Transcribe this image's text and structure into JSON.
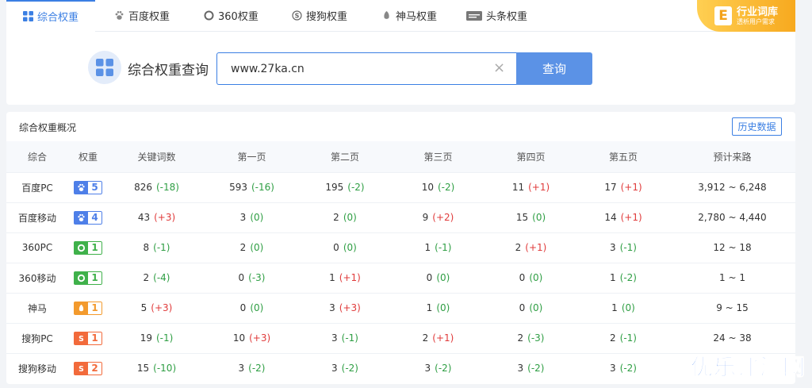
{
  "tabs": [
    {
      "label": "综合权重",
      "icon": "grid-icon",
      "active": true
    },
    {
      "label": "百度权重",
      "icon": "baidu-paw-icon"
    },
    {
      "label": "360权重",
      "icon": "360-ring-icon"
    },
    {
      "label": "搜狗权重",
      "icon": "sogou-s-icon"
    },
    {
      "label": "神马权重",
      "icon": "shenma-icon"
    },
    {
      "label": "头条权重",
      "icon": "toutiao-icon"
    }
  ],
  "banner": {
    "title": "行业词库",
    "subtitle": "透析用户需求",
    "icon_letter": "E"
  },
  "search": {
    "title": "综合权重查询",
    "value": "www.27ka.cn",
    "button_label": "查询"
  },
  "table": {
    "title": "综合权重概况",
    "history_label": "历史数据",
    "headers": [
      "综合",
      "权重",
      "关键词数",
      "第一页",
      "第二页",
      "第三页",
      "第四页",
      "第五页",
      "预计来路"
    ],
    "rows": [
      {
        "name": "百度PC",
        "engine": "baidu",
        "weight": "5",
        "cells": [
          [
            "826",
            "(-18)"
          ],
          [
            "593",
            "(-16)"
          ],
          [
            "195",
            "(-2)"
          ],
          [
            "10",
            "(-2)"
          ],
          [
            "11",
            "(+1)"
          ],
          [
            "17",
            "(+1)"
          ]
        ],
        "traffic": "3,912 ~ 6,248"
      },
      {
        "name": "百度移动",
        "engine": "baidu",
        "weight": "4",
        "cells": [
          [
            "43",
            "(+3)"
          ],
          [
            "3",
            "(0)"
          ],
          [
            "2",
            "(0)"
          ],
          [
            "9",
            "(+2)"
          ],
          [
            "15",
            "(0)"
          ],
          [
            "14",
            "(+1)"
          ]
        ],
        "traffic": "2,780 ~ 4,440"
      },
      {
        "name": "360PC",
        "engine": "360",
        "weight": "1",
        "cells": [
          [
            "8",
            "(-1)"
          ],
          [
            "2",
            "(0)"
          ],
          [
            "0",
            "(0)"
          ],
          [
            "1",
            "(-1)"
          ],
          [
            "2",
            "(+1)"
          ],
          [
            "3",
            "(-1)"
          ]
        ],
        "traffic": "12 ~ 18"
      },
      {
        "name": "360移动",
        "engine": "360",
        "weight": "1",
        "cells": [
          [
            "2",
            "(-4)"
          ],
          [
            "0",
            "(-3)"
          ],
          [
            "1",
            "(+1)"
          ],
          [
            "0",
            "(0)"
          ],
          [
            "0",
            "(0)"
          ],
          [
            "1",
            "(-2)"
          ]
        ],
        "traffic": "1 ~ 1"
      },
      {
        "name": "神马",
        "engine": "shenma",
        "weight": "1",
        "cells": [
          [
            "5",
            "(+3)"
          ],
          [
            "0",
            "(0)"
          ],
          [
            "3",
            "(+3)"
          ],
          [
            "1",
            "(0)"
          ],
          [
            "0",
            "(0)"
          ],
          [
            "1",
            "(0)"
          ]
        ],
        "traffic": "9 ~ 15"
      },
      {
        "name": "搜狗PC",
        "engine": "sogou",
        "weight": "1",
        "cells": [
          [
            "19",
            "(-1)"
          ],
          [
            "10",
            "(+3)"
          ],
          [
            "3",
            "(-1)"
          ],
          [
            "2",
            "(+1)"
          ],
          [
            "2",
            "(-3)"
          ],
          [
            "2",
            "(-1)"
          ]
        ],
        "traffic": "24 ~ 38"
      },
      {
        "name": "搜狗移动",
        "engine": "sogou",
        "weight": "2",
        "cells": [
          [
            "15",
            "(-10)"
          ],
          [
            "3",
            "(-2)"
          ],
          [
            "3",
            "(-2)"
          ],
          [
            "3",
            "(-2)"
          ],
          [
            "3",
            "(-2)"
          ],
          [
            "3",
            "(-2)"
          ]
        ],
        "traffic": ""
      }
    ]
  },
  "engine_colors": {
    "baidu": "#4e7fe8",
    "360": "#3fb14a",
    "shenma": "#f39a2d",
    "sogou": "#f26a3b"
  },
  "watermark": "优乐评测网"
}
